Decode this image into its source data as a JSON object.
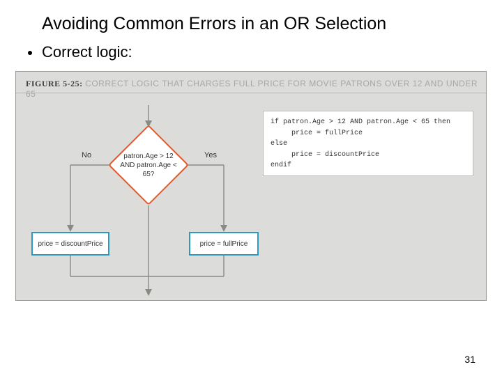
{
  "title": "Avoiding Common Errors in an OR Selection",
  "bullet": "Correct logic:",
  "figure": {
    "label": "FIGURE 5-25:",
    "caption": "CORRECT LOGIC THAT CHARGES FULL PRICE FOR MOVIE PATRONS OVER 12 AND UNDER 65"
  },
  "flow": {
    "decision_l1": "patron.Age > 12",
    "decision_l2": "AND patron.Age <",
    "decision_l3": "65?",
    "no": "No",
    "yes": "Yes",
    "left_box": "price = discountPrice",
    "right_box": "price = fullPrice"
  },
  "code": {
    "l1": "if patron.Age > 12 AND patron.Age < 65 then",
    "l2": "     price = fullPrice",
    "l3": "else",
    "l4": "     price = discountPrice",
    "l5": "endif"
  },
  "page": "31"
}
